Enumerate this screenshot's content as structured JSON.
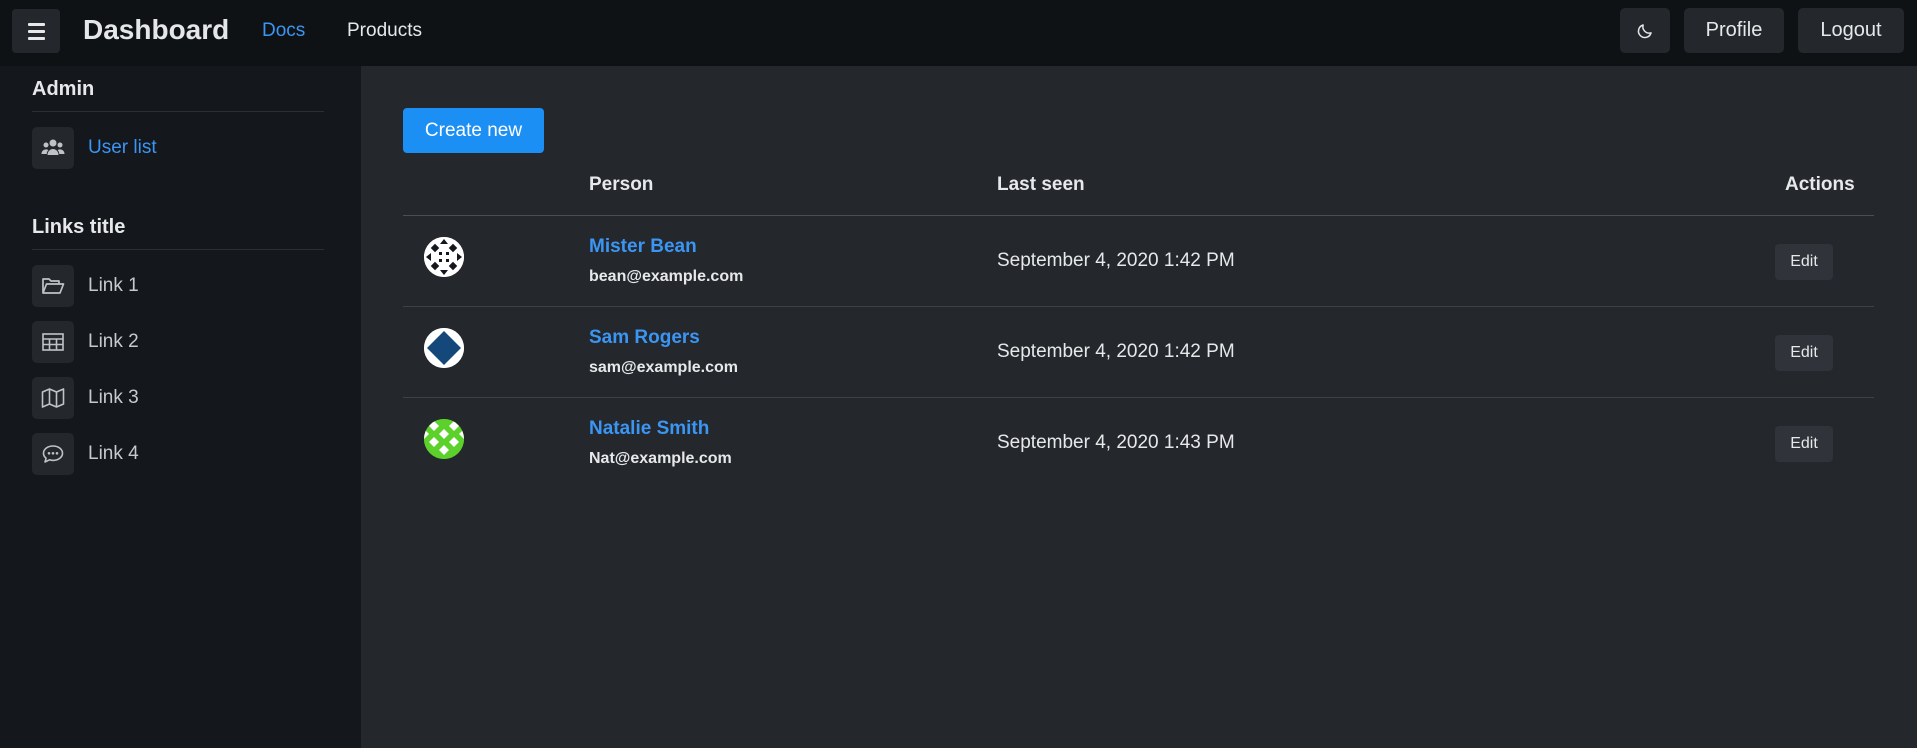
{
  "header": {
    "brand": "Dashboard",
    "nav": [
      {
        "label": "Docs",
        "active": true
      },
      {
        "label": "Products",
        "active": false
      }
    ],
    "theme_icon": "moon-icon",
    "profile_label": "Profile",
    "logout_label": "Logout",
    "menu_icon": "hamburger-menu-icon"
  },
  "sidebar": {
    "sections": [
      {
        "title": "Admin",
        "items": [
          {
            "label": "User list",
            "icon": "users-icon",
            "active": true
          }
        ]
      },
      {
        "title": "Links title",
        "items": [
          {
            "label": "Link 1",
            "icon": "folder-open-icon"
          },
          {
            "label": "Link 2",
            "icon": "table-icon"
          },
          {
            "label": "Link 3",
            "icon": "map-icon"
          },
          {
            "label": "Link 4",
            "icon": "chat-icon"
          }
        ]
      }
    ]
  },
  "main": {
    "create_label": "Create new",
    "columns": [
      "Person",
      "Last seen",
      "Actions"
    ],
    "rows": [
      {
        "name": "Mister Bean",
        "email": "bean@example.com",
        "last_seen": "September 4, 2020 1:42 PM",
        "action": "Edit",
        "avatar_color": "#ffffff"
      },
      {
        "name": "Sam Rogers",
        "email": "sam@example.com",
        "last_seen": "September 4, 2020 1:42 PM",
        "action": "Edit",
        "avatar_color": "#14477a"
      },
      {
        "name": "Natalie Smith",
        "email": "Nat@example.com",
        "last_seen": "September 4, 2020 1:43 PM",
        "action": "Edit",
        "avatar_color": "#5dd12b"
      }
    ]
  },
  "colors": {
    "accent": "#1c8ff5",
    "link": "#3b95f3",
    "navbar_bg": "#0f1215",
    "sidebar_bg": "#14171b",
    "main_bg": "#24272c"
  }
}
